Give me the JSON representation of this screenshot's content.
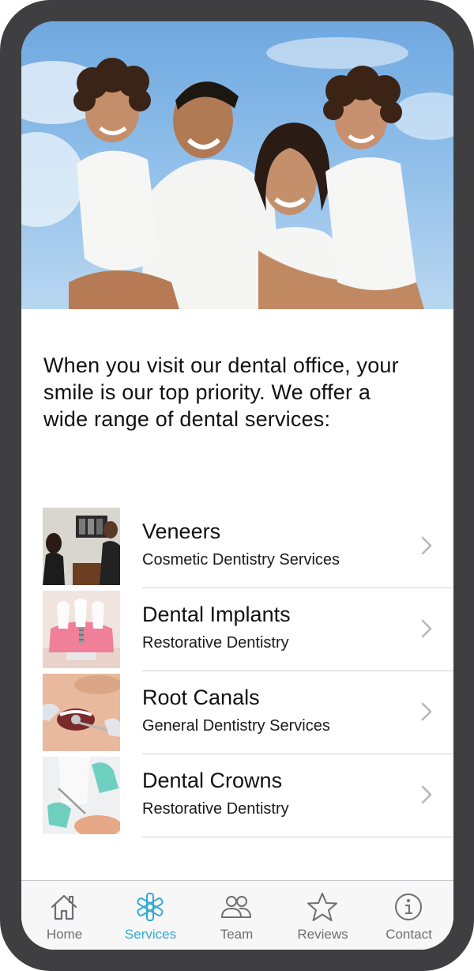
{
  "intro_text": "When you visit our dental office, your smile is our top priority. We offer a wide range of dental services:",
  "services": [
    {
      "title": "Veneers",
      "subtitle": "Cosmetic Dentistry Services"
    },
    {
      "title": "Dental Implants",
      "subtitle": "Restorative Dentistry"
    },
    {
      "title": "Root Canals",
      "subtitle": "General Dentistry Services"
    },
    {
      "title": "Dental Crowns",
      "subtitle": "Restorative Dentistry"
    }
  ],
  "tabs": [
    {
      "label": "Home",
      "icon": "home-icon"
    },
    {
      "label": "Services",
      "icon": "asterisk-icon",
      "active": true
    },
    {
      "label": "Team",
      "icon": "people-icon"
    },
    {
      "label": "Reviews",
      "icon": "star-icon"
    },
    {
      "label": "Contact",
      "icon": "info-icon"
    }
  ],
  "colors": {
    "accent": "#34a9d2",
    "tab_inactive": "#6e6e73",
    "frame": "#3f3f41",
    "divider": "#d2d2d4"
  }
}
